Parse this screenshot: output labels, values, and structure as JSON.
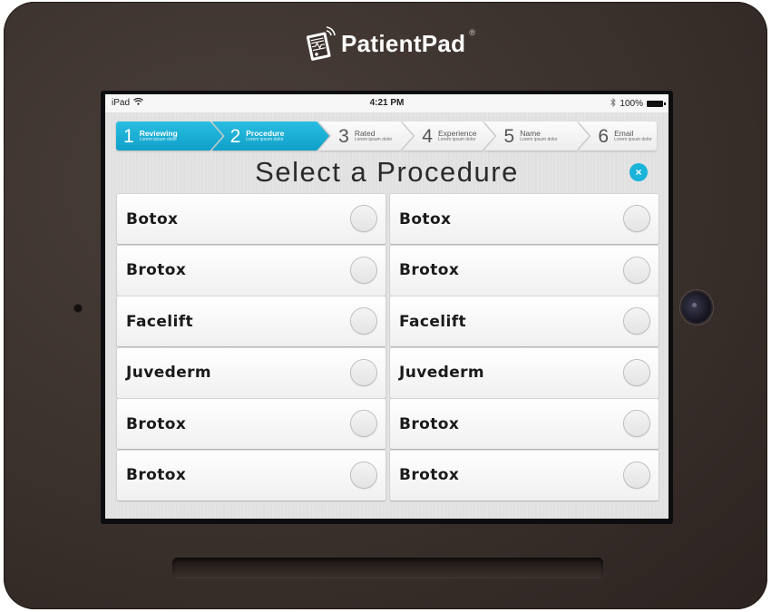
{
  "brand": {
    "name": "PatientPad",
    "registered_mark": "®"
  },
  "statusbar": {
    "device": "iPad",
    "time": "4:21 PM",
    "battery": "100%"
  },
  "stepper": {
    "steps": [
      {
        "number": "1",
        "title": "Reviewing",
        "subtitle": "Lorem ipsum dolor",
        "state": "active"
      },
      {
        "number": "2",
        "title": "Procedure",
        "subtitle": "Lorem ipsum dolor",
        "state": "active"
      },
      {
        "number": "3",
        "title": "Rated",
        "subtitle": "Lorem ipsum dolor",
        "state": "inactive"
      },
      {
        "number": "4",
        "title": "Experience",
        "subtitle": "Lorem ipsum dolor",
        "state": "inactive"
      },
      {
        "number": "5",
        "title": "Name",
        "subtitle": "Lorem ipsum dolor",
        "state": "inactive"
      },
      {
        "number": "6",
        "title": "Email",
        "subtitle": "Lorem ipsum dolor",
        "state": "inactive"
      }
    ]
  },
  "page": {
    "title": "Select a Procedure",
    "close_icon": "×"
  },
  "procedures": {
    "left": [
      "Botox",
      "Brotox",
      "Facelift",
      "Juvederm",
      "Brotox",
      "Brotox"
    ],
    "right": [
      "Botox",
      "Brotox",
      "Facelift",
      "Juvederm",
      "Brotox",
      "Brotox"
    ]
  },
  "colors": {
    "accent": "#1ab3d9",
    "active_step_top": "#29bde0",
    "active_step_bottom": "#0fa0c9",
    "device_body": "#3a302c"
  }
}
